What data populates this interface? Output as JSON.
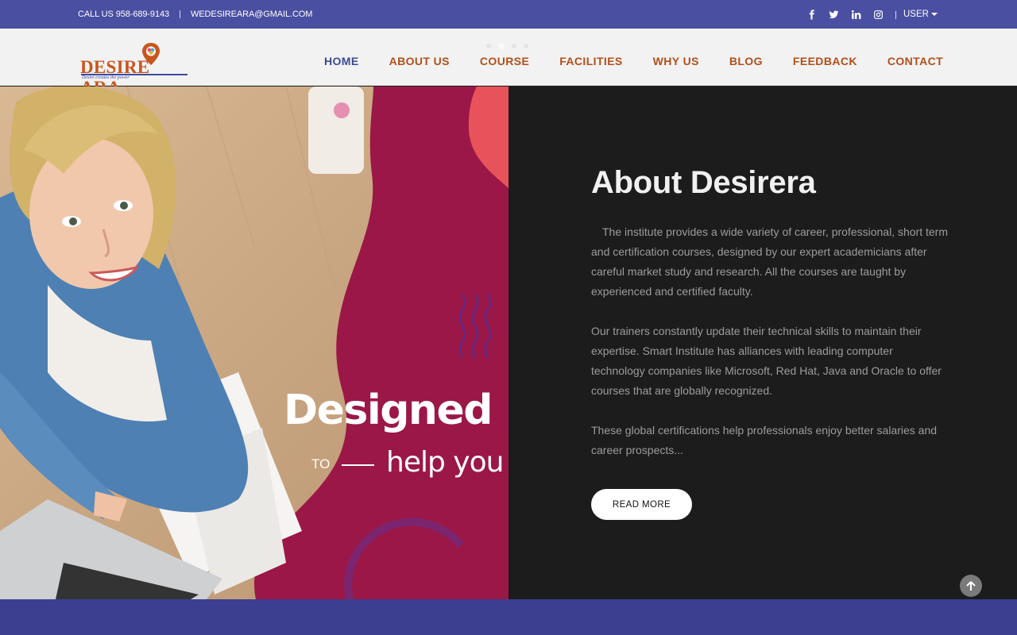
{
  "topbar": {
    "phone": "CALL US 958-689-9143",
    "email": "WEDESIREARA@GMAIL.COM",
    "social": [
      "facebook-icon",
      "twitter-icon",
      "linkedin-icon",
      "instagram-icon"
    ],
    "user_label": "USER"
  },
  "logo": {
    "wordmark_left": "DESIRE",
    "wordmark_right": "ARA",
    "tagline": "Desire creates the power"
  },
  "nav": {
    "items": [
      {
        "label": "HOME",
        "active": true
      },
      {
        "label": "ABOUT US",
        "active": false
      },
      {
        "label": "COURSE",
        "active": false
      },
      {
        "label": "FACILITIES",
        "active": false
      },
      {
        "label": "WHY US",
        "active": false
      },
      {
        "label": "BLOG",
        "active": false
      },
      {
        "label": "FEEDBACK",
        "active": false
      },
      {
        "label": "CONTACT",
        "active": false
      }
    ]
  },
  "hero": {
    "slogan_main": "Designed",
    "slogan_to": "TO",
    "slogan_sub": "help you"
  },
  "about": {
    "title": "About Desirera",
    "paragraphs": [
      "The institute provides a wide variety of career, professional, short term and certification courses, designed by our expert academicians after careful market study and research. All the courses are taught by experienced and certified faculty.",
      "Our trainers constantly update their technical skills to maintain their expertise. Smart Institute  has alliances with leading computer technology companies like Microsoft, Red Hat, Java and Oracle to offer courses that are globally recognized.",
      "These global certifications help professionals enjoy better salaries and career prospects..."
    ],
    "read_more_label": "READ MORE"
  },
  "colors": {
    "topbar_bg": "#4a4fa1",
    "nav_link": "#b24f19",
    "nav_active": "#3a4a94",
    "hero_magenta": "#9b1747",
    "about_bg": "#1c1c1c"
  }
}
